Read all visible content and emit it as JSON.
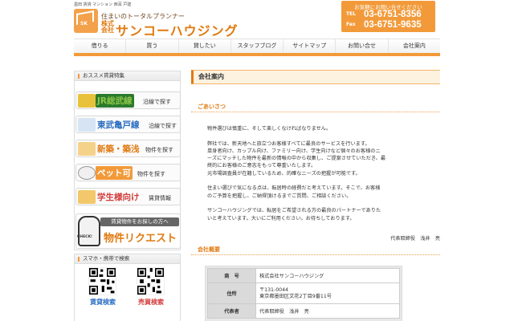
{
  "header": {
    "topline": "墨田 賃貸 マンション 西耳 戸建",
    "logo_tagline": "住まいのトータルプランナー",
    "logo_kk": "株式会社",
    "logo_name": "サンコーハウジング",
    "contact": {
      "heading": "お気軽にお問い合せください",
      "tel_label": "TEL",
      "tel": "03-6751-8356",
      "fax_label": "Fax",
      "fax": "03-6751-9635"
    }
  },
  "nav": [
    "借りる",
    "買う",
    "貸したい",
    "スタッフブログ",
    "サイトマップ",
    "お問い合せ",
    "会社案内"
  ],
  "sidebar": {
    "feature_heading": "おススメ賃貸特集",
    "banners": [
      {
        "big": "JR総武線",
        "small": "沿線で探す",
        "color": "#8ac44a",
        "bg": "#2c7a2c"
      },
      {
        "big": "東武亀戸線",
        "small": "沿線で探す",
        "color": "#2a6dc1",
        "bg": "#ffffff"
      },
      {
        "big": "新築・築浅",
        "small": "物件を探す",
        "color": "#e07a10",
        "bg": "#ffffff"
      },
      {
        "big": "ペット可",
        "small": "物件を探す",
        "color": "#ffffff",
        "bg": "#f29a3a"
      },
      {
        "big": "学生様向け",
        "small": "賃貸情報",
        "color": "#d23a3a",
        "bg": "#ffffff"
      }
    ],
    "request": {
      "check": "CHECK!",
      "line1": "賃貸物件をお探しの方へ",
      "line2": "物件リクエスト"
    },
    "mobile_heading": "スマホ・携帯で検索",
    "qr": [
      {
        "label": "賃貸検索",
        "color": "#2a6dc1"
      },
      {
        "label": "売買検索",
        "color": "#d23a3a"
      }
    ]
  },
  "main": {
    "title": "会社案内",
    "greeting_title": "ごあいさつ",
    "greeting": [
      "物件選びは慎重に、そして楽しくなければなりません。",
      "",
      "弊社では、新天地へと旅立つお客様すべてに最良のサービスを行います。",
      "単身者向け、カップル向け、ファミリー向け、学生向けなど個々のお客様のニ",
      "ーズにマッチした物件を最新の情報の中から収集し、ご提案させていただき、最",
      "終的にお客様のご意志をもって尊重いたします。",
      "元市場調査員が在籍しているため、的確なニーズの把握が可能です。",
      "",
      "住まい選びで気になる点は、転居時の経費だと考えています。そこで、お客様",
      "のご予算を把握し、ご納得頂けるまでご質問、ご相談ください。",
      "",
      "サンコーハウジングでは、転居をご希望される方の最良のパートナーでありた",
      "いと考えています。大いにご利用ください。お待ちしております。"
    ],
    "signature": "代表取締役　浅井　亮",
    "overview_title": "会社概要",
    "overview": [
      {
        "key": "商　号",
        "value": "株式会社サンコーハウジング"
      },
      {
        "key": "住所",
        "value": "〒131-0044",
        "value2": "東京都墨田区文花2丁目9番11号"
      },
      {
        "key": "代表者",
        "value": "代表取締役　浅井　亮"
      }
    ]
  }
}
